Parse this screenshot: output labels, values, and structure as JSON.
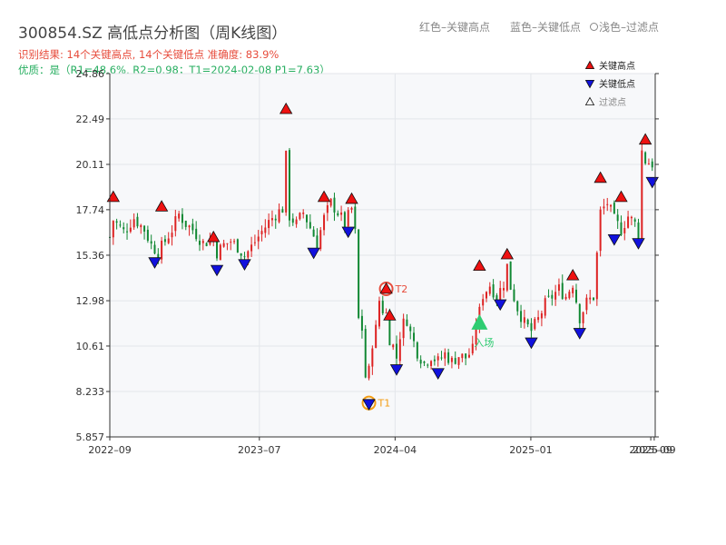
{
  "header": {
    "title": "300854.SZ 高低点分析图（周K线图）",
    "hint_red": "红色–关键高点",
    "hint_blue": "蓝色–关键低点",
    "hint_light": "浅色–过滤点",
    "result_line": "识别结果: 14个关键高点, 14个关键低点   准确度: 83.9%",
    "quality_line": "优质：是（R1=48.6%, R2=0.98；T1=2024-02-08 P1=7.63）"
  },
  "colors": {
    "up": "#dd2222",
    "down": "#118833",
    "high_marker": "#ee1111",
    "low_marker": "#1111dd",
    "entry": "#2ecc71",
    "t1": "#f39c12",
    "t2": "#e74c3c",
    "plot_bg": "#f7f8fa"
  },
  "chart_data": {
    "type": "candlestick",
    "y_ticks": [
      "5.857",
      "8.233",
      "10.61",
      "12.98",
      "15.36",
      "17.74",
      "20.11",
      "22.49",
      "24.86"
    ],
    "ylim": [
      5.857,
      24.86
    ],
    "x_ticks": [
      {
        "label": "2022–09",
        "date": "2022-09-01"
      },
      {
        "label": "2023–07",
        "date": "2023-07-01"
      },
      {
        "label": "2024–04",
        "date": "2024-04-01"
      },
      {
        "label": "2025–01",
        "date": "2025-01-01"
      },
      {
        "label": "2025–09",
        "date": "2025-09-01"
      },
      {
        "label": "2025–09",
        "date": "2025-09-08"
      }
    ],
    "xlim": [
      "2022-09-01",
      "2025-09-10"
    ],
    "legend": {
      "position": "top-right",
      "entries": [
        {
          "label": "关键高点",
          "marker": "high"
        },
        {
          "label": "关键低点",
          "marker": "low"
        },
        {
          "label": "过滤点",
          "marker": "filtered"
        }
      ]
    },
    "close_path": [
      [
        "2022-09-01",
        16.3
      ],
      [
        "2022-09-08",
        17.2
      ],
      [
        "2022-09-29",
        16.6
      ],
      [
        "2022-10-20",
        17.3
      ],
      [
        "2022-11-10",
        16.7
      ],
      [
        "2022-11-24",
        15.9
      ],
      [
        "2022-12-08",
        15.5
      ],
      [
        "2022-12-22",
        16.1
      ],
      [
        "2023-01-05",
        16.7
      ],
      [
        "2023-01-19",
        17.5
      ],
      [
        "2023-02-02",
        17.0
      ],
      [
        "2023-02-16",
        16.7
      ],
      [
        "2023-03-09",
        16.0
      ],
      [
        "2023-03-30",
        16.2
      ],
      [
        "2023-04-06",
        15.5
      ],
      [
        "2023-04-20",
        15.9
      ],
      [
        "2023-05-04",
        16.1
      ],
      [
        "2023-05-18",
        15.8
      ],
      [
        "2023-06-01",
        15.3
      ],
      [
        "2023-06-15",
        15.8
      ],
      [
        "2023-07-06",
        16.6
      ],
      [
        "2023-07-20",
        17.1
      ],
      [
        "2023-08-03",
        17.5
      ],
      [
        "2023-08-17",
        17.8
      ],
      [
        "2023-08-24",
        20.5
      ],
      [
        "2023-08-31",
        17.4
      ],
      [
        "2023-09-14",
        17.0
      ],
      [
        "2023-09-28",
        17.6
      ],
      [
        "2023-10-12",
        16.8
      ],
      [
        "2023-10-26",
        16.0
      ],
      [
        "2023-11-09",
        17.3
      ],
      [
        "2023-11-23",
        18.1
      ],
      [
        "2023-12-07",
        17.6
      ],
      [
        "2023-12-21",
        17.0
      ],
      [
        "2024-01-04",
        17.8
      ],
      [
        "2024-01-11",
        16.5
      ],
      [
        "2024-01-18",
        12.0
      ],
      [
        "2024-01-25",
        11.5
      ],
      [
        "2024-02-01",
        9.0
      ],
      [
        "2024-02-08",
        9.3
      ],
      [
        "2024-02-15",
        10.8
      ],
      [
        "2024-02-22",
        11.5
      ],
      [
        "2024-02-29",
        13.0
      ],
      [
        "2024-03-07",
        12.5
      ],
      [
        "2024-03-14",
        12.3
      ],
      [
        "2024-03-21",
        11.0
      ],
      [
        "2024-03-28",
        10.6
      ],
      [
        "2024-04-04",
        10.0
      ],
      [
        "2024-04-11",
        11.2
      ],
      [
        "2024-04-18",
        11.8
      ],
      [
        "2024-04-25",
        12.0
      ],
      [
        "2024-05-02",
        11.3
      ],
      [
        "2024-05-16",
        10.3
      ],
      [
        "2024-05-30",
        9.7
      ],
      [
        "2024-06-13",
        10.1
      ],
      [
        "2024-06-27",
        9.8
      ],
      [
        "2024-07-11",
        10.2
      ],
      [
        "2024-07-25",
        9.8
      ],
      [
        "2024-08-08",
        10.1
      ],
      [
        "2024-08-22",
        10.0
      ],
      [
        "2024-09-05",
        10.4
      ],
      [
        "2024-09-12",
        11.8
      ],
      [
        "2024-09-19",
        12.4
      ],
      [
        "2024-09-26",
        13.3
      ],
      [
        "2024-10-10",
        13.8
      ],
      [
        "2024-10-24",
        13.2
      ],
      [
        "2024-11-07",
        13.9
      ],
      [
        "2024-11-14",
        14.8
      ],
      [
        "2024-11-21",
        13.7
      ],
      [
        "2024-12-05",
        12.6
      ],
      [
        "2024-12-19",
        11.8
      ],
      [
        "2025-01-02",
        11.4
      ],
      [
        "2025-01-16",
        12.0
      ],
      [
        "2025-01-30",
        12.8
      ],
      [
        "2025-02-13",
        13.2
      ],
      [
        "2025-02-27",
        13.6
      ],
      [
        "2025-03-13",
        13.2
      ],
      [
        "2025-03-27",
        13.9
      ],
      [
        "2025-04-10",
        12.1
      ],
      [
        "2025-04-24",
        12.9
      ],
      [
        "2025-05-08",
        13.2
      ],
      [
        "2025-05-22",
        17.6
      ],
      [
        "2025-06-05",
        18.1
      ],
      [
        "2025-06-19",
        17.2
      ],
      [
        "2025-07-03",
        16.7
      ],
      [
        "2025-07-17",
        17.4
      ],
      [
        "2025-07-31",
        17.0
      ],
      [
        "2025-08-07",
        16.4
      ],
      [
        "2025-08-14",
        20.8
      ],
      [
        "2025-08-21",
        20.3
      ],
      [
        "2025-09-08",
        20.1
      ]
    ],
    "key_highs": [
      {
        "date": "2022-09-08",
        "value": 18.4
      },
      {
        "date": "2022-12-15",
        "value": 17.9
      },
      {
        "date": "2023-03-30",
        "value": 16.3
      },
      {
        "date": "2023-08-24",
        "value": 23.0
      },
      {
        "date": "2023-11-09",
        "value": 18.4
      },
      {
        "date": "2024-01-04",
        "value": 18.3
      },
      {
        "date": "2024-03-21",
        "value": 12.2
      },
      {
        "date": "2024-09-19",
        "value": 14.8
      },
      {
        "date": "2024-11-14",
        "value": 15.4
      },
      {
        "date": "2025-03-27",
        "value": 14.3
      },
      {
        "date": "2025-05-22",
        "value": 19.4
      },
      {
        "date": "2025-07-03",
        "value": 18.4
      },
      {
        "date": "2025-08-21",
        "value": 21.4
      }
    ],
    "key_lows": [
      {
        "date": "2022-12-01",
        "value": 15.0
      },
      {
        "date": "2023-04-06",
        "value": 14.6
      },
      {
        "date": "2023-06-01",
        "value": 14.9
      },
      {
        "date": "2023-10-19",
        "value": 15.5
      },
      {
        "date": "2023-12-28",
        "value": 16.6
      },
      {
        "date": "2024-04-04",
        "value": 9.4
      },
      {
        "date": "2024-06-27",
        "value": 9.2
      },
      {
        "date": "2024-10-31",
        "value": 12.8
      },
      {
        "date": "2025-01-02",
        "value": 10.8
      },
      {
        "date": "2025-04-10",
        "value": 11.3
      },
      {
        "date": "2025-06-19",
        "value": 16.2
      },
      {
        "date": "2025-08-07",
        "value": 16.0
      },
      {
        "date": "2025-09-04",
        "value": 19.2
      }
    ],
    "annotations": [
      {
        "label": "T1",
        "kind": "t1",
        "date": "2024-02-08",
        "value": 7.63
      },
      {
        "label": "T2",
        "kind": "t2",
        "date": "2024-03-14",
        "value": 13.6
      },
      {
        "label": "入场",
        "kind": "entry",
        "date": "2024-09-19",
        "value": 11.8
      }
    ]
  }
}
